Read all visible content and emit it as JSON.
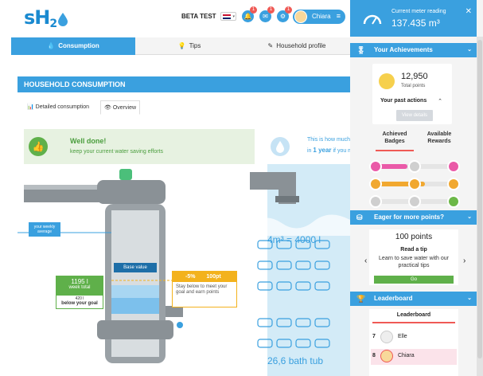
{
  "header": {
    "logo": {
      "s": "s",
      "h": "H",
      "two": "2"
    },
    "beta_label": "BETA TEST",
    "language_caret": "▾",
    "notifications": {
      "icon": "bell-icon",
      "count": "1"
    },
    "messages": {
      "icon": "envelope-icon",
      "count": "1"
    },
    "settings": {
      "icon": "gear-icon",
      "count": "1"
    },
    "user": {
      "name": "Chiara",
      "menu_glyph": "≡"
    }
  },
  "nav": {
    "tabs": [
      {
        "label": "Consumption",
        "icon": "drop-icon",
        "glyph": "💧",
        "active": true
      },
      {
        "label": "Tips",
        "icon": "lightbulb-icon",
        "glyph": "💡",
        "active": false
      },
      {
        "label": "Household profile",
        "icon": "pencil-icon",
        "glyph": "✎",
        "active": false
      }
    ]
  },
  "main": {
    "title": "HOUSEHOLD CONSUMPTION",
    "subtabs": [
      {
        "label": "Detailed consumption",
        "glyph": "📊",
        "active": false
      },
      {
        "label": "Overview",
        "glyph": "👁",
        "active": true
      }
    ],
    "feedback": {
      "title": "Well done!",
      "subtitle": "keep your current water saving efforts"
    },
    "tank": {
      "weekly_average_label": "your weekly average",
      "base_value_label": "Base value",
      "week_total": {
        "value": "1195 l",
        "label": "week total",
        "below_value": "420 l",
        "below_label": "below your goal"
      },
      "goal": {
        "percent": "-5%",
        "points": "100pt",
        "text": "Stay below to meet your goal and earn points"
      }
    },
    "comparison": {
      "line1": "This is how much you t",
      "line2_prefix": "in",
      "line2_highlight": "1 year",
      "line2_suffix": "if you meet",
      "volume_text": "4m³ = 4000 l",
      "bathtubs_text": "26,6 bath tub"
    }
  },
  "sidebar": {
    "meter": {
      "label": "Current meter reading",
      "value": "137.435 m³",
      "icon": "gauge-icon",
      "close_glyph": "✕"
    },
    "achievements": {
      "title": "Your Achievements",
      "icon": "ribbon-icon",
      "glyph": "🎖",
      "points_value": "12,950",
      "points_label": "Total points",
      "past_actions": "Your past actions",
      "past_caret": "⌃",
      "view_details": "View details",
      "tab_badges": "Achieved Badges",
      "tab_rewards": "Available Rewards",
      "badges": [
        {
          "color": "#ea5aa8",
          "fill": 0.42
        },
        {
          "color": "#f1a830",
          "fill": 0.62
        },
        {
          "color": "#6cb848",
          "fill": 0.0
        }
      ]
    },
    "more_points": {
      "title": "Eager for more points?",
      "icon": "coins-icon",
      "glyph": "⛁",
      "points": "100 points",
      "tip_title": "Read a tip",
      "tip_text": "Learn to save water with our practical tips",
      "go_label": "Go",
      "prev_glyph": "‹",
      "next_glyph": "›"
    },
    "leaderboard": {
      "title": "Leaderboard",
      "icon": "trophy-icon",
      "glyph": "🏆",
      "tab_label": "Leaderboard",
      "rows": [
        {
          "rank": "7",
          "name": "Elle",
          "me": false
        },
        {
          "rank": "8",
          "name": "Chiara",
          "me": true
        }
      ]
    },
    "section_caret": "⌄"
  }
}
